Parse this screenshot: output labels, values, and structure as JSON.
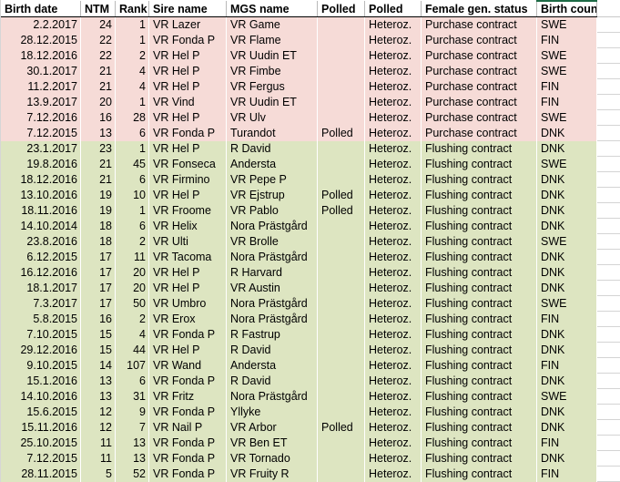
{
  "table": {
    "name": "sire-mgs-listing-table",
    "columns": [
      {
        "key": "birth_date",
        "label": "Birth date",
        "align": "right"
      },
      {
        "key": "ntm",
        "label": "NTM",
        "align": "right"
      },
      {
        "key": "rank",
        "label": "Rank",
        "align": "right"
      },
      {
        "key": "sire_name",
        "label": "Sire name",
        "align": "left"
      },
      {
        "key": "mgs_name",
        "label": "MGS name",
        "align": "left"
      },
      {
        "key": "polled_sire",
        "label": "Polled",
        "align": "left"
      },
      {
        "key": "polled_status",
        "label": "Polled",
        "align": "left"
      },
      {
        "key": "female_gen_status",
        "label": "Female gen. status",
        "align": "left"
      },
      {
        "key": "birth_country",
        "label": "Birth country",
        "align": "left"
      }
    ],
    "groups": [
      {
        "name": "purchase-contract-group",
        "fill_color": "#f6dbd7",
        "rows": [
          {
            "birth_date": "2.2.2017",
            "ntm": "24",
            "rank": "1",
            "sire_name": "VR Lazer",
            "mgs_name": "VR Game",
            "polled_sire": "",
            "polled_status": "Heteroz.",
            "female_gen_status": "Purchase contract",
            "birth_country": "SWE"
          },
          {
            "birth_date": "28.12.2015",
            "ntm": "22",
            "rank": "1",
            "sire_name": "VR Fonda P",
            "mgs_name": "VR Flame",
            "polled_sire": "",
            "polled_status": "Heteroz.",
            "female_gen_status": "Purchase contract",
            "birth_country": "FIN"
          },
          {
            "birth_date": "18.12.2016",
            "ntm": "22",
            "rank": "2",
            "sire_name": "VR Hel P",
            "mgs_name": "VR Uudin ET",
            "polled_sire": "",
            "polled_status": "Heteroz.",
            "female_gen_status": "Purchase contract",
            "birth_country": "SWE"
          },
          {
            "birth_date": "30.1.2017",
            "ntm": "21",
            "rank": "4",
            "sire_name": "VR Hel P",
            "mgs_name": "VR Fimbe",
            "polled_sire": "",
            "polled_status": "Heteroz.",
            "female_gen_status": "Purchase contract",
            "birth_country": "SWE"
          },
          {
            "birth_date": "11.2.2017",
            "ntm": "21",
            "rank": "4",
            "sire_name": "VR Hel P",
            "mgs_name": "VR Fergus",
            "polled_sire": "",
            "polled_status": "Heteroz.",
            "female_gen_status": "Purchase contract",
            "birth_country": "FIN"
          },
          {
            "birth_date": "13.9.2017",
            "ntm": "20",
            "rank": "1",
            "sire_name": "VR Vind",
            "mgs_name": "VR Uudin ET",
            "polled_sire": "",
            "polled_status": "Heteroz.",
            "female_gen_status": "Purchase contract",
            "birth_country": "FIN"
          },
          {
            "birth_date": "7.12.2016",
            "ntm": "16",
            "rank": "28",
            "sire_name": "VR Hel P",
            "mgs_name": "VR Ulv",
            "polled_sire": "",
            "polled_status": "Heteroz.",
            "female_gen_status": "Purchase contract",
            "birth_country": "SWE"
          },
          {
            "birth_date": "7.12.2015",
            "ntm": "13",
            "rank": "6",
            "sire_name": "VR Fonda P",
            "mgs_name": "Turandot",
            "polled_sire": "Polled",
            "polled_status": "Heteroz.",
            "female_gen_status": "Purchase contract",
            "birth_country": "DNK"
          }
        ]
      },
      {
        "name": "flushing-contract-group",
        "fill_color": "#dde5c1",
        "rows": [
          {
            "birth_date": "23.1.2017",
            "ntm": "23",
            "rank": "1",
            "sire_name": "VR Hel P",
            "mgs_name": "R David",
            "polled_sire": "",
            "polled_status": "Heteroz.",
            "female_gen_status": "Flushing contract",
            "birth_country": "DNK"
          },
          {
            "birth_date": "19.8.2016",
            "ntm": "21",
            "rank": "45",
            "sire_name": "VR Fonseca",
            "mgs_name": "Andersta",
            "polled_sire": "",
            "polled_status": "Heteroz.",
            "female_gen_status": "Flushing contract",
            "birth_country": "SWE"
          },
          {
            "birth_date": "18.12.2016",
            "ntm": "21",
            "rank": "6",
            "sire_name": "VR Firmino",
            "mgs_name": "VR Pepe P",
            "polled_sire": "",
            "polled_status": "Heteroz.",
            "female_gen_status": "Flushing contract",
            "birth_country": "DNK"
          },
          {
            "birth_date": "13.10.2016",
            "ntm": "19",
            "rank": "10",
            "sire_name": "VR Hel P",
            "mgs_name": "VR Ejstrup",
            "polled_sire": "Polled",
            "polled_status": "Heteroz.",
            "female_gen_status": "Flushing contract",
            "birth_country": "DNK"
          },
          {
            "birth_date": "18.11.2016",
            "ntm": "19",
            "rank": "1",
            "sire_name": "VR Froome",
            "mgs_name": "VR Pablo",
            "polled_sire": "Polled",
            "polled_status": "Heteroz.",
            "female_gen_status": "Flushing contract",
            "birth_country": "DNK"
          },
          {
            "birth_date": "14.10.2014",
            "ntm": "18",
            "rank": "6",
            "sire_name": "VR Helix",
            "mgs_name": "Nora Prästgård",
            "polled_sire": "",
            "polled_status": "Heteroz.",
            "female_gen_status": "Flushing contract",
            "birth_country": "DNK"
          },
          {
            "birth_date": "23.8.2016",
            "ntm": "18",
            "rank": "2",
            "sire_name": "VR Ulti",
            "mgs_name": "VR Brolle",
            "polled_sire": "",
            "polled_status": "Heteroz.",
            "female_gen_status": "Flushing contract",
            "birth_country": "SWE"
          },
          {
            "birth_date": "6.12.2015",
            "ntm": "17",
            "rank": "11",
            "sire_name": "VR Tacoma",
            "mgs_name": "Nora Prästgård",
            "polled_sire": "",
            "polled_status": "Heteroz.",
            "female_gen_status": "Flushing contract",
            "birth_country": "DNK"
          },
          {
            "birth_date": "16.12.2016",
            "ntm": "17",
            "rank": "20",
            "sire_name": "VR Hel P",
            "mgs_name": "R Harvard",
            "polled_sire": "",
            "polled_status": "Heteroz.",
            "female_gen_status": "Flushing contract",
            "birth_country": "DNK"
          },
          {
            "birth_date": "18.1.2017",
            "ntm": "17",
            "rank": "20",
            "sire_name": "VR Hel P",
            "mgs_name": "VR Austin",
            "polled_sire": "",
            "polled_status": "Heteroz.",
            "female_gen_status": "Flushing contract",
            "birth_country": "DNK"
          },
          {
            "birth_date": "7.3.2017",
            "ntm": "17",
            "rank": "50",
            "sire_name": "VR Umbro",
            "mgs_name": "Nora Prästgård",
            "polled_sire": "",
            "polled_status": "Heteroz.",
            "female_gen_status": "Flushing contract",
            "birth_country": "SWE"
          },
          {
            "birth_date": "5.8.2015",
            "ntm": "16",
            "rank": "2",
            "sire_name": "VR Erox",
            "mgs_name": "Nora Prästgård",
            "polled_sire": "",
            "polled_status": "Heteroz.",
            "female_gen_status": "Flushing contract",
            "birth_country": "FIN"
          },
          {
            "birth_date": "7.10.2015",
            "ntm": "15",
            "rank": "4",
            "sire_name": "VR Fonda P",
            "mgs_name": "R Fastrup",
            "polled_sire": "",
            "polled_status": "Heteroz.",
            "female_gen_status": "Flushing contract",
            "birth_country": "DNK"
          },
          {
            "birth_date": "29.12.2016",
            "ntm": "15",
            "rank": "44",
            "sire_name": "VR Hel P",
            "mgs_name": "R David",
            "polled_sire": "",
            "polled_status": "Heteroz.",
            "female_gen_status": "Flushing contract",
            "birth_country": "DNK"
          },
          {
            "birth_date": "9.10.2015",
            "ntm": "14",
            "rank": "107",
            "sire_name": "VR Wand",
            "mgs_name": "Andersta",
            "polled_sire": "",
            "polled_status": "Heteroz.",
            "female_gen_status": "Flushing contract",
            "birth_country": "FIN"
          },
          {
            "birth_date": "15.1.2016",
            "ntm": "13",
            "rank": "6",
            "sire_name": "VR Fonda P",
            "mgs_name": "R David",
            "polled_sire": "",
            "polled_status": "Heteroz.",
            "female_gen_status": "Flushing contract",
            "birth_country": "DNK"
          },
          {
            "birth_date": "14.10.2016",
            "ntm": "13",
            "rank": "31",
            "sire_name": "VR Fritz",
            "mgs_name": "Nora Prästgård",
            "polled_sire": "",
            "polled_status": "Heteroz.",
            "female_gen_status": "Flushing contract",
            "birth_country": "SWE"
          },
          {
            "birth_date": "15.6.2015",
            "ntm": "12",
            "rank": "9",
            "sire_name": "VR Fonda P",
            "mgs_name": "Yllyke",
            "polled_sire": "",
            "polled_status": "Heteroz.",
            "female_gen_status": "Flushing contract",
            "birth_country": "DNK"
          },
          {
            "birth_date": "15.11.2016",
            "ntm": "12",
            "rank": "7",
            "sire_name": "VR Nail P",
            "mgs_name": "VR Arbor",
            "polled_sire": "Polled",
            "polled_status": "Heteroz.",
            "female_gen_status": "Flushing contract",
            "birth_country": "DNK"
          },
          {
            "birth_date": "25.10.2015",
            "ntm": "11",
            "rank": "13",
            "sire_name": "VR Fonda P",
            "mgs_name": "VR Ben ET",
            "polled_sire": "",
            "polled_status": "Heteroz.",
            "female_gen_status": "Flushing contract",
            "birth_country": "FIN"
          },
          {
            "birth_date": "7.12.2015",
            "ntm": "11",
            "rank": "13",
            "sire_name": "VR Fonda P",
            "mgs_name": "VR Tornado",
            "polled_sire": "",
            "polled_status": "Heteroz.",
            "female_gen_status": "Flushing contract",
            "birth_country": "DNK"
          },
          {
            "birth_date": "28.11.2015",
            "ntm": "5",
            "rank": "52",
            "sire_name": "VR Fonda P",
            "mgs_name": "VR Fruity R",
            "polled_sire": "",
            "polled_status": "Heteroz.",
            "female_gen_status": "Flushing contract",
            "birth_country": "FIN"
          }
        ]
      }
    ]
  },
  "colors": {
    "group_purchase_fill": "#f6dbd7",
    "group_flushing_fill": "#dde5c1",
    "header_underline": "#000000",
    "birth_country_top_accent": "#1d6a45"
  }
}
